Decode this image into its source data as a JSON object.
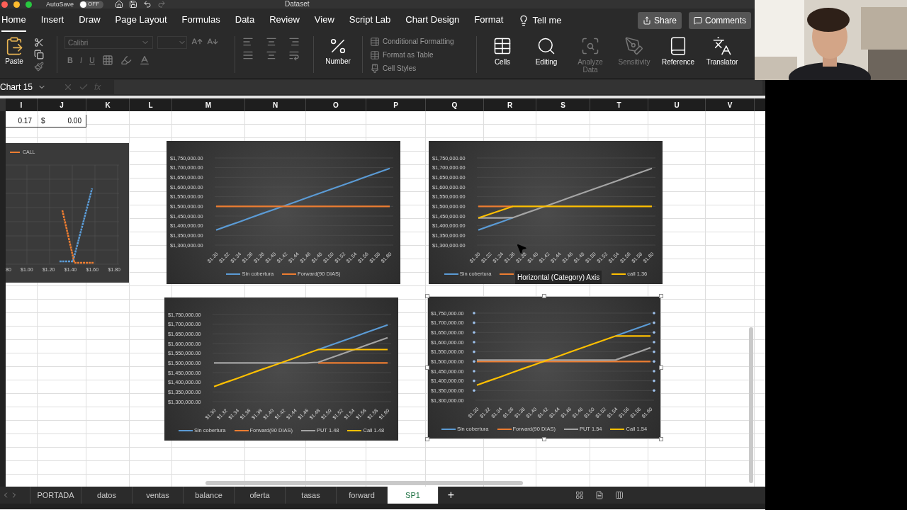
{
  "window": {
    "autosave_label": "AutoSave",
    "autosave_on": false,
    "autosave_state": "OFF",
    "title": "Dataset"
  },
  "ribbon_tabs": [
    {
      "label": "Home",
      "selected": true
    },
    {
      "label": "Insert",
      "selected": false
    },
    {
      "label": "Draw",
      "selected": false
    },
    {
      "label": "Page Layout",
      "selected": false
    },
    {
      "label": "Formulas",
      "selected": false
    },
    {
      "label": "Data",
      "selected": false
    },
    {
      "label": "Review",
      "selected": false
    },
    {
      "label": "View",
      "selected": false
    },
    {
      "label": "Script Lab",
      "selected": false
    },
    {
      "label": "Chart Design",
      "selected": false
    },
    {
      "label": "Format",
      "selected": false
    }
  ],
  "tell_me": "Tell me",
  "share": "Share",
  "comments": "Comments",
  "ribbon": {
    "paste": "Paste",
    "font_name": "Calibri",
    "font_disabled": true,
    "font_styles": [
      "B",
      "I",
      "U"
    ],
    "number": "Number",
    "styles": [
      {
        "kind": "conditional",
        "label": "Conditional Formatting",
        "disabled": true
      },
      {
        "kind": "table",
        "label": "Format as Table",
        "disabled": true
      },
      {
        "kind": "cellstyles",
        "label": "Cell Styles",
        "disabled": true
      }
    ],
    "commands": [
      {
        "kind": "cells",
        "label": "Cells",
        "disabled": false
      },
      {
        "kind": "editing",
        "label": "Editing",
        "disabled": false
      },
      {
        "kind": "analyze",
        "label": "Analyze Data",
        "disabled": true
      },
      {
        "kind": "sensitivity",
        "label": "Sensitivity",
        "disabled": true
      },
      {
        "kind": "reference",
        "label": "Reference",
        "disabled": false
      },
      {
        "kind": "translator",
        "label": "Translator",
        "disabled": false
      }
    ]
  },
  "name_box": "Chart 15",
  "fx_label": "fx",
  "columns": [
    "I",
    "J",
    "K",
    "L",
    "M",
    "N",
    "O",
    "P",
    "Q",
    "R",
    "S",
    "T",
    "U",
    "V"
  ],
  "visible_row": {
    "column_i": "0.17",
    "column_j_symbol": "$",
    "column_j_value": "0.00"
  },
  "mini_chart": {
    "legend": "CALL",
    "x_labels": [
      "80",
      "$1.00",
      "$1.20",
      "$1.40",
      "$1.60",
      "$1.80"
    ]
  },
  "charts": [
    {
      "selected": false,
      "chart_data": {
        "type": "line",
        "grid": true,
        "legend": "bottom",
        "ylim": [
          1300000,
          1750000
        ],
        "categories": [
          "$1.30",
          "$1.32",
          "$1.34",
          "$1.36",
          "$1.38",
          "$1.40",
          "$1.42",
          "$1.44",
          "$1.46",
          "$1.48",
          "$1.50",
          "$1.52",
          "$1.54",
          "$1.56",
          "$1.58",
          "$1.60"
        ],
        "yticks": [
          {
            "value": 1300000,
            "label": "$1,300,000.00"
          },
          {
            "value": 1350000,
            "label": "$1,350,000.00"
          },
          {
            "value": 1400000,
            "label": "$1,400,000.00"
          },
          {
            "value": 1450000,
            "label": "$1,450,000.00"
          },
          {
            "value": 1500000,
            "label": "$1,500,000.00"
          },
          {
            "value": 1550000,
            "label": "$1,550,000.00"
          },
          {
            "value": 1600000,
            "label": "$1,600,000.00"
          },
          {
            "value": 1650000,
            "label": "$1,650,000.00"
          },
          {
            "value": 1700000,
            "label": "$1,700,000.00"
          },
          {
            "value": 1750000,
            "label": "$1,750,000.00"
          }
        ],
        "series": [
          {
            "name": "Sin cobertura",
            "color": "#5b9bd5",
            "values": [
              1378000,
              1399000,
              1420000,
              1442000,
              1463000,
              1484000,
              1505000,
              1526000,
              1548000,
              1569000,
              1590000,
              1611000,
              1632000,
              1654000,
              1675000,
              1696000
            ]
          },
          {
            "name": "Forward(90 DIAS)",
            "color": "#ed7d31",
            "values": [
              1500000,
              1500000,
              1500000,
              1500000,
              1500000,
              1500000,
              1500000,
              1500000,
              1500000,
              1500000,
              1500000,
              1500000,
              1500000,
              1500000,
              1500000,
              1500000
            ]
          }
        ]
      }
    },
    {
      "selected": false,
      "chart_data": {
        "type": "line",
        "grid": true,
        "legend": "bottom",
        "ylim": [
          1300000,
          1750000
        ],
        "categories": [
          "$1.30",
          "$1.32",
          "$1.34",
          "$1.36",
          "$1.38",
          "$1.40",
          "$1.42",
          "$1.44",
          "$1.46",
          "$1.48",
          "$1.50",
          "$1.52",
          "$1.54",
          "$1.56",
          "$1.58",
          "$1.60"
        ],
        "yticks": [
          {
            "value": 1300000,
            "label": "$1,300,000.00"
          },
          {
            "value": 1350000,
            "label": "$1,350,000.00"
          },
          {
            "value": 1400000,
            "label": "$1,400,000.00"
          },
          {
            "value": 1450000,
            "label": "$1,450,000.00"
          },
          {
            "value": 1500000,
            "label": "$1,500,000.00"
          },
          {
            "value": 1550000,
            "label": "$1,550,000.00"
          },
          {
            "value": 1600000,
            "label": "$1,600,000.00"
          },
          {
            "value": 1650000,
            "label": "$1,650,000.00"
          },
          {
            "value": 1700000,
            "label": "$1,700,000.00"
          },
          {
            "value": 1750000,
            "label": "$1,750,000.00"
          }
        ],
        "series": [
          {
            "name": "Sin cobertura",
            "color": "#5b9bd5",
            "values": [
              1378000,
              1399000,
              1420000,
              1442000,
              null,
              null,
              null,
              null,
              null,
              null,
              null,
              null,
              null,
              null,
              null,
              null
            ]
          },
          {
            "color": "#ed7d31",
            "values": [
              1500000,
              1500000,
              1500000,
              1500000,
              null,
              null,
              null,
              null,
              null,
              null,
              null,
              null,
              null,
              null,
              null,
              null
            ]
          },
          {
            "color": "#a5a5a5",
            "values": [
              1440000,
              1440000,
              1440000,
              1442000,
              1463000,
              1484000,
              1505000,
              1526000,
              1548000,
              1569000,
              1590000,
              1611000,
              1632000,
              1654000,
              1675000,
              1696000
            ]
          },
          {
            "name": "call 1.36",
            "color": "#ffc000",
            "values": [
              1440000,
              1460000,
              1480000,
              1500000,
              1500000,
              1500000,
              1500000,
              1500000,
              1500000,
              1500000,
              1500000,
              1500000,
              1500000,
              1500000,
              1500000,
              1500000
            ]
          }
        ]
      }
    },
    {
      "selected": false,
      "chart_data": {
        "type": "line",
        "grid": true,
        "legend": "bottom",
        "ylim": [
          1300000,
          1750000
        ],
        "categories": [
          "$1.30",
          "$1.32",
          "$1.34",
          "$1.36",
          "$1.38",
          "$1.40",
          "$1.42",
          "$1.44",
          "$1.46",
          "$1.48",
          "$1.50",
          "$1.52",
          "$1.54",
          "$1.56",
          "$1.58",
          "$1.60"
        ],
        "yticks": [
          {
            "value": 1300000,
            "label": "$1,300,000.00"
          },
          {
            "value": 1350000,
            "label": "$1,350,000.00"
          },
          {
            "value": 1400000,
            "label": "$1,400,000.00"
          },
          {
            "value": 1450000,
            "label": "$1,450,000.00"
          },
          {
            "value": 1500000,
            "label": "$1,500,000.00"
          },
          {
            "value": 1550000,
            "label": "$1,550,000.00"
          },
          {
            "value": 1600000,
            "label": "$1,600,000.00"
          },
          {
            "value": 1650000,
            "label": "$1,650,000.00"
          },
          {
            "value": 1700000,
            "label": "$1,700,000.00"
          },
          {
            "value": 1750000,
            "label": "$1,750,000.00"
          }
        ],
        "series": [
          {
            "name": "Sin cobertura",
            "color": "#5b9bd5",
            "values": [
              null,
              null,
              null,
              null,
              null,
              null,
              null,
              null,
              null,
              1569000,
              1590000,
              1611000,
              1632000,
              1654000,
              1675000,
              1696000
            ]
          },
          {
            "name": "Forward(90 DIAS)",
            "color": "#ed7d31",
            "values": [
              null,
              null,
              null,
              null,
              null,
              null,
              null,
              null,
              null,
              1500000,
              1500000,
              1500000,
              1500000,
              1500000,
              1500000,
              1500000
            ]
          },
          {
            "name": "PUT 1.48",
            "color": "#a5a5a5",
            "values": [
              1500000,
              1500000,
              1500000,
              1500000,
              1500000,
              1500000,
              1500000,
              1500000,
              1500000,
              1503000,
              1524000,
              1545000,
              1566000,
              1588000,
              1609000,
              1630000
            ]
          },
          {
            "name": "Call 1.48",
            "color": "#ffc000",
            "values": [
              1378000,
              1399000,
              1420000,
              1442000,
              1463000,
              1484000,
              1505000,
              1526000,
              1548000,
              1569000,
              1569000,
              1569000,
              1569000,
              1569000,
              1569000,
              1569000
            ]
          }
        ]
      }
    },
    {
      "selected": true,
      "chart_data": {
        "type": "line",
        "grid": true,
        "legend": "bottom",
        "ylim": [
          1300000,
          1750000
        ],
        "categories": [
          "$1.30",
          "$1.32",
          "$1.34",
          "$1.36",
          "$1.38",
          "$1.40",
          "$1.42",
          "$1.44",
          "$1.46",
          "$1.48",
          "$1.50",
          "$1.52",
          "$1.54",
          "$1.56",
          "$1.58",
          "$1.60"
        ],
        "yticks": [
          {
            "value": 1300000,
            "label": "$1,300,000.00"
          },
          {
            "value": 1350000,
            "label": "$1,350,000.00"
          },
          {
            "value": 1400000,
            "label": "$1,400,000.00"
          },
          {
            "value": 1450000,
            "label": "$1,450,000.00"
          },
          {
            "value": 1500000,
            "label": "$1,500,000.00"
          },
          {
            "value": 1550000,
            "label": "$1,550,000.00"
          },
          {
            "value": 1600000,
            "label": "$1,600,000.00"
          },
          {
            "value": 1650000,
            "label": "$1,650,000.00"
          },
          {
            "value": 1700000,
            "label": "$1,700,000.00"
          },
          {
            "value": 1750000,
            "label": "$1,750,000.00"
          }
        ],
        "series": [
          {
            "name": "Sin cobertura",
            "color": "#5b9bd5",
            "values": [
              null,
              null,
              null,
              null,
              null,
              null,
              null,
              null,
              null,
              null,
              null,
              null,
              1632000,
              1654000,
              1675000,
              1696000
            ]
          },
          {
            "name": "Forward(90 DIAS)",
            "color": "#ed7d31",
            "values": [
              1500000,
              1500000,
              1500000,
              1500000,
              1500000,
              1500000,
              1500000,
              1500000,
              1500000,
              1500000,
              1500000,
              1500000,
              1500000,
              1500000,
              1500000,
              1500000
            ]
          },
          {
            "name": "PUT 1.54",
            "color": "#a5a5a5",
            "values": [
              1507000,
              1507000,
              1507000,
              1507000,
              1507000,
              1507000,
              1507000,
              1507000,
              1507000,
              1507000,
              1507000,
              1507000,
              1508000,
              1529000,
              1550000,
              1571000
            ]
          },
          {
            "name": "Call 1.54",
            "color": "#ffc000",
            "values": [
              1378000,
              1399000,
              1420000,
              1442000,
              1463000,
              1484000,
              1505000,
              1526000,
              1548000,
              1569000,
              1590000,
              1611000,
              1632000,
              1632000,
              1632000,
              1632000
            ]
          }
        ]
      }
    }
  ],
  "tooltip": "Horizontal (Category) Axis",
  "sheet_tabs": [
    {
      "label": "PORTADA",
      "selected": false
    },
    {
      "label": "datos",
      "selected": false
    },
    {
      "label": "ventas",
      "selected": false
    },
    {
      "label": "balance",
      "selected": false
    },
    {
      "label": "oferta",
      "selected": false
    },
    {
      "label": "tasas",
      "selected": false
    },
    {
      "label": "forward",
      "selected": false
    },
    {
      "label": "SP1",
      "selected": true
    }
  ],
  "add_sheet": "+"
}
